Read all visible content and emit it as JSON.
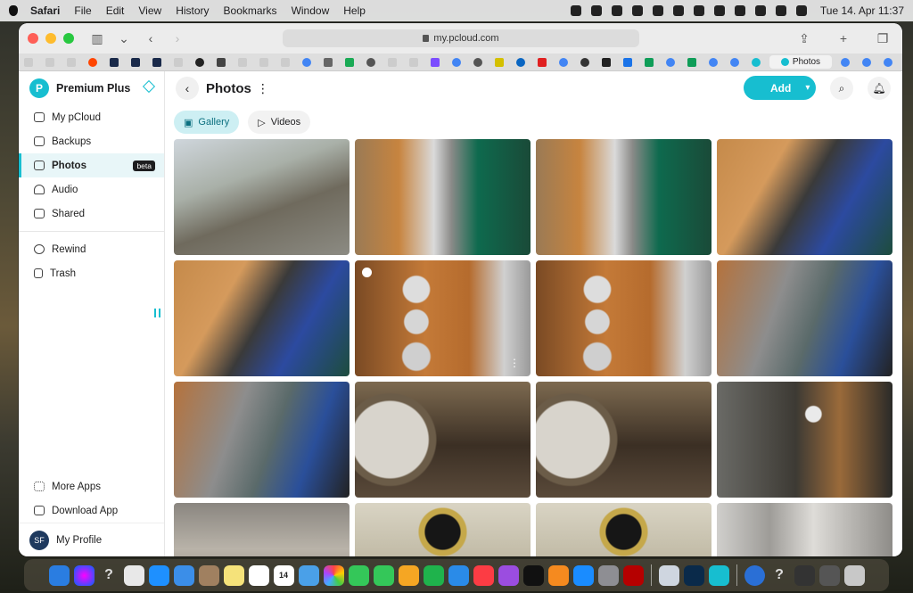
{
  "menubar": {
    "app": "Safari",
    "items": [
      "File",
      "Edit",
      "View",
      "History",
      "Bookmarks",
      "Window",
      "Help"
    ],
    "clock": "Tue 14. Apr  11:37"
  },
  "browser": {
    "url": "my.pcloud.com",
    "active_tab_label": "Photos"
  },
  "sidebar": {
    "brand": "Premium Plus",
    "logo_letter": "P",
    "items": [
      {
        "label": "My pCloud",
        "icon": "cloud-icon"
      },
      {
        "label": "Backups",
        "icon": "cloud-upload-icon"
      },
      {
        "label": "Photos",
        "icon": "photo-icon",
        "badge": "beta",
        "active": true
      },
      {
        "label": "Audio",
        "icon": "headphones-icon"
      },
      {
        "label": "Shared",
        "icon": "shared-icon"
      }
    ],
    "secondary": [
      {
        "label": "Rewind",
        "icon": "rewind-icon"
      },
      {
        "label": "Trash",
        "icon": "trash-icon"
      }
    ],
    "bottom": [
      {
        "label": "More Apps",
        "icon": "grid-icon"
      },
      {
        "label": "Download App",
        "icon": "download-icon"
      }
    ],
    "profile": {
      "initials": "SF",
      "label": "My Profile"
    }
  },
  "main": {
    "title": "Photos",
    "add_label": "Add",
    "tabs": [
      {
        "label": "Gallery",
        "active": true
      },
      {
        "label": "Videos",
        "active": false
      }
    ],
    "photos": [
      "street-scene",
      "copper-still",
      "copper-still",
      "man-drinking",
      "man-tasting",
      "still-portholes",
      "still-portholes",
      "two-men",
      "two-men",
      "drop-closeup",
      "drop-closeup",
      "pour-glass",
      "blur-glass",
      "jar-lids",
      "jar-lids",
      "pipes"
    ]
  },
  "dock": {
    "calendar_day": "14"
  }
}
